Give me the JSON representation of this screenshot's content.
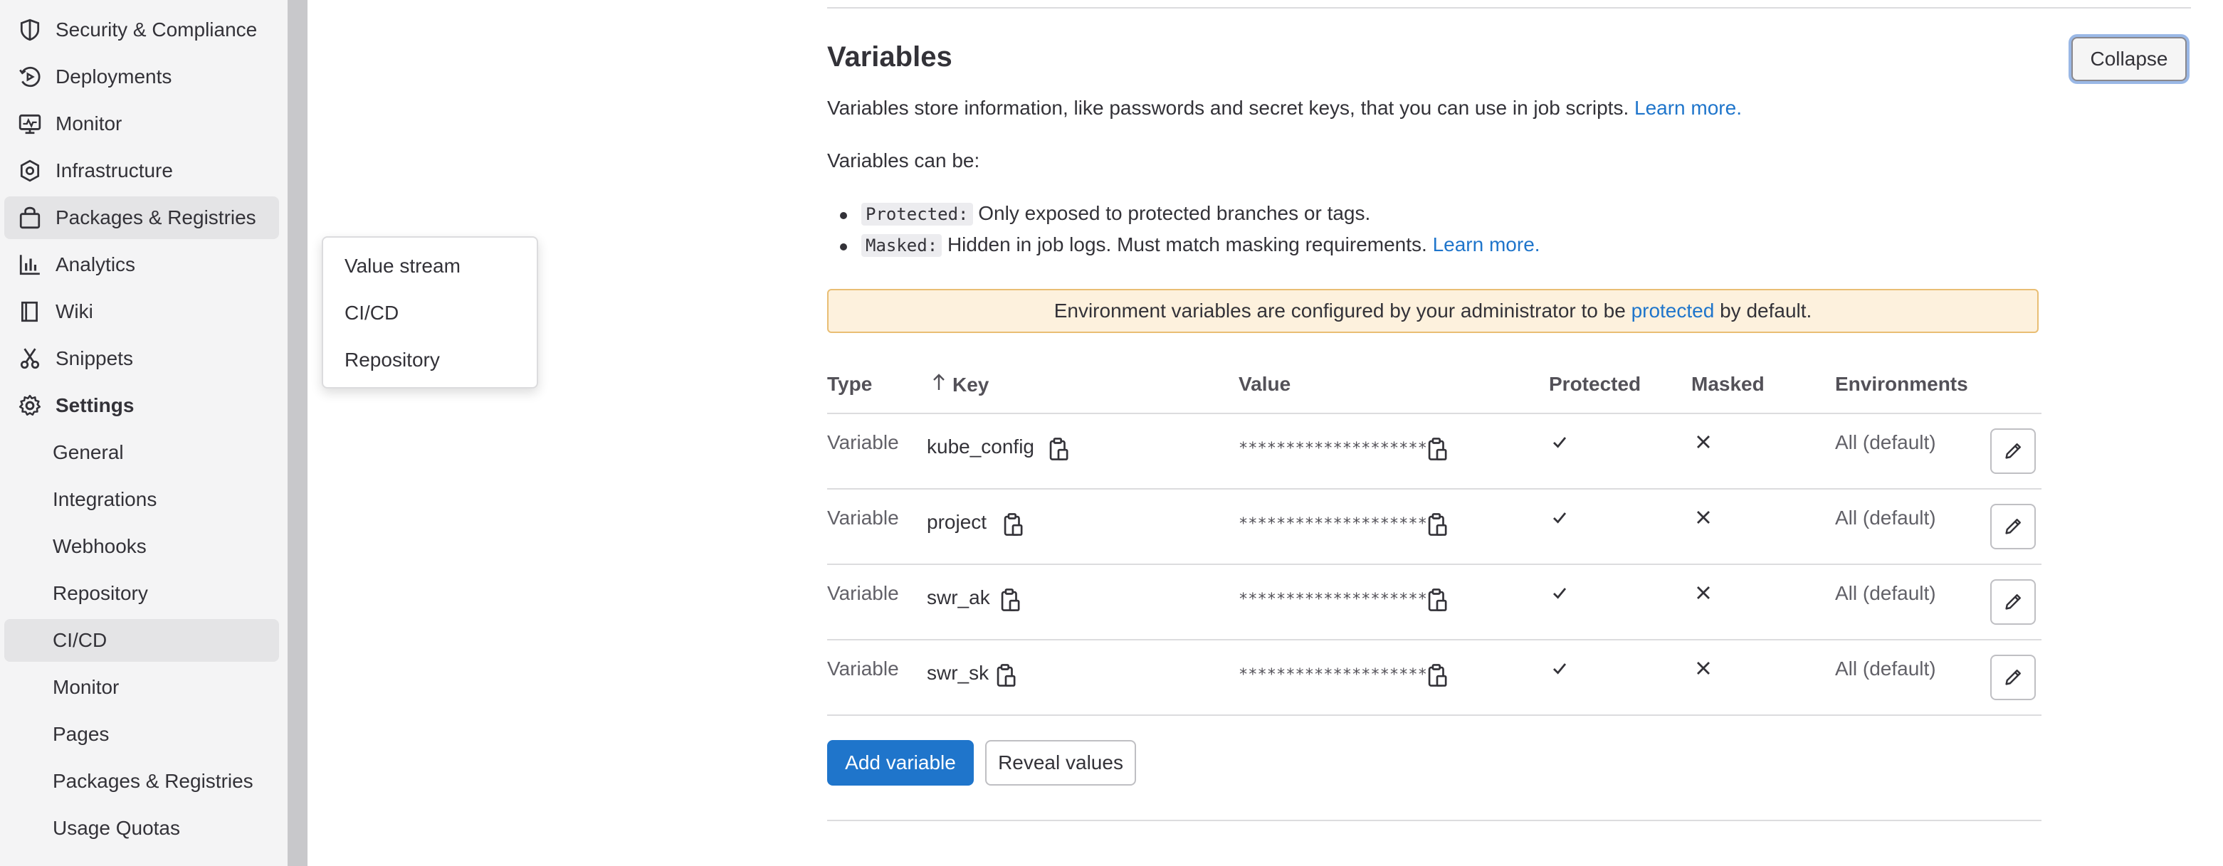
{
  "sidebar": {
    "items": [
      {
        "label": "Security & Compliance",
        "icon": "shield-icon"
      },
      {
        "label": "Deployments",
        "icon": "deployments-icon"
      },
      {
        "label": "Monitor",
        "icon": "monitor-icon"
      },
      {
        "label": "Infrastructure",
        "icon": "infrastructure-icon"
      },
      {
        "label": "Packages & Registries",
        "icon": "package-icon"
      },
      {
        "label": "Analytics",
        "icon": "analytics-icon"
      },
      {
        "label": "Wiki",
        "icon": "book-icon"
      },
      {
        "label": "Snippets",
        "icon": "scissors-icon"
      },
      {
        "label": "Settings",
        "icon": "gear-icon"
      }
    ],
    "settings_subitems": [
      "General",
      "Integrations",
      "Webhooks",
      "Repository",
      "CI/CD",
      "Monitor",
      "Pages",
      "Packages & Registries",
      "Usage Quotas"
    ]
  },
  "flyout": {
    "items": [
      "Value stream",
      "CI/CD",
      "Repository"
    ]
  },
  "section": {
    "title": "Variables",
    "collapse_label": "Collapse",
    "description": "Variables store information, like passwords and secret keys, that you can use in job scripts.",
    "learn_more": "Learn more.",
    "can_be": "Variables can be:",
    "protected_tag": "Protected:",
    "protected_text": "Only exposed to protected branches or tags.",
    "masked_tag": "Masked:",
    "masked_text": "Hidden in job logs. Must match masking requirements.",
    "alert_before": "Environment variables are configured by your administrator to be",
    "alert_link": "protected",
    "alert_after": "by default."
  },
  "table": {
    "headers": {
      "type": "Type",
      "key": "Key",
      "value": "Value",
      "protected": "Protected",
      "masked": "Masked",
      "environments": "Environments"
    },
    "rows": [
      {
        "type": "Variable",
        "key": "kube_config",
        "value": "********************",
        "environment": "All (default)"
      },
      {
        "type": "Variable",
        "key": "project",
        "value": "********************",
        "environment": "All (default)"
      },
      {
        "type": "Variable",
        "key": "swr_ak",
        "value": "********************",
        "environment": "All (default)"
      },
      {
        "type": "Variable",
        "key": "swr_sk",
        "value": "********************",
        "environment": "All (default)"
      }
    ]
  },
  "buttons": {
    "add": "Add variable",
    "reveal": "Reveal values"
  },
  "colors": {
    "accent": "#1f75cb",
    "alert_bg": "#fdf1dd",
    "sidebar_bg": "#f4f4f5"
  }
}
